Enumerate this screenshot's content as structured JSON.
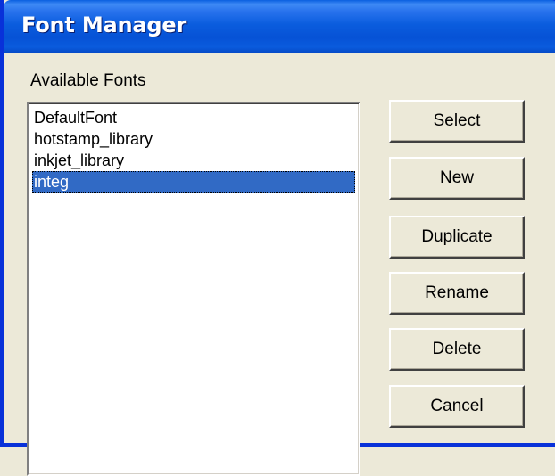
{
  "window": {
    "title": "Font Manager"
  },
  "fonts_panel": {
    "label": "Available Fonts",
    "items": [
      {
        "label": "DefaultFont",
        "selected": false
      },
      {
        "label": "hotstamp_library",
        "selected": false
      },
      {
        "label": "inkjet_library",
        "selected": false
      },
      {
        "label": "integ",
        "selected": true
      }
    ]
  },
  "buttons": {
    "select": "Select",
    "new": "New",
    "duplicate": "Duplicate",
    "rename": "Rename",
    "delete": "Delete",
    "cancel": "Cancel"
  },
  "colors": {
    "titlebar": "#0A5BDD",
    "selection": "#316AC5",
    "dialog_background": "#ECE9D8"
  }
}
